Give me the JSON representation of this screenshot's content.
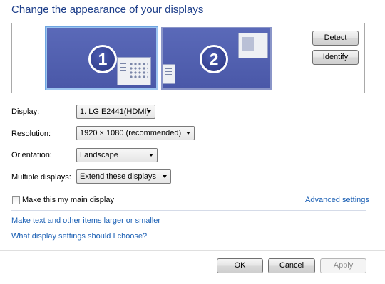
{
  "title": "Change the appearance of your displays",
  "monitors": [
    {
      "number": "1"
    },
    {
      "number": "2"
    }
  ],
  "buttons": {
    "detect": "Detect",
    "identify": "Identify",
    "ok": "OK",
    "cancel": "Cancel",
    "apply": "Apply"
  },
  "settings": {
    "display": {
      "label": "Display:",
      "value": "1. LG E2441(HDMI)"
    },
    "resolution": {
      "label": "Resolution:",
      "value": "1920 × 1080 (recommended)"
    },
    "orientation": {
      "label": "Orientation:",
      "value": "Landscape"
    },
    "multiple": {
      "label": "Multiple displays:",
      "value": "Extend these displays"
    }
  },
  "main_display_checkbox": {
    "label": "Make this my main display",
    "checked": false
  },
  "links": {
    "advanced": "Advanced settings",
    "text_size": "Make text and other items larger or smaller",
    "help": "What display settings should I choose?"
  },
  "colors": {
    "title": "#1e3f8a",
    "link": "#1a5fb4",
    "monitor_fill": "#4a58a8"
  }
}
